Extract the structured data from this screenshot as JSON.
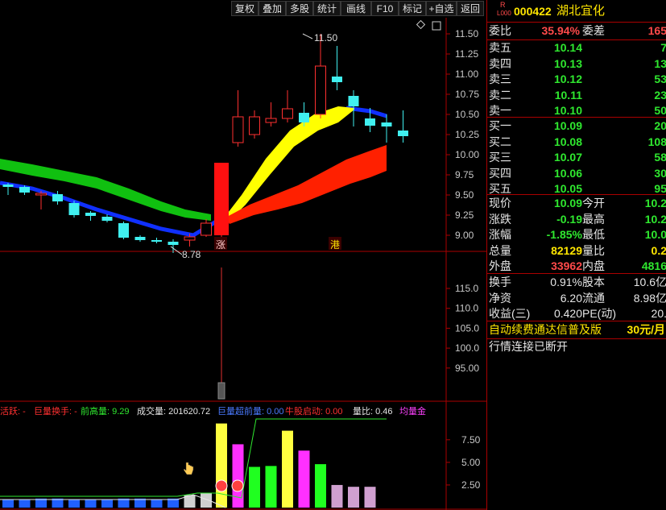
{
  "toolbar": {
    "buttons": [
      "复权",
      "叠加",
      "多股",
      "统计",
      "画线",
      "F10",
      "标记",
      "+自选",
      "返回"
    ]
  },
  "price_chart": {
    "y_ticks": [
      "11.50",
      "11.25",
      "11.00",
      "10.75",
      "10.50",
      "10.25",
      "10.00",
      "9.75",
      "9.50",
      "9.25",
      "9.00"
    ],
    "high_label": "11.50",
    "low_label": "8.78",
    "markers": [
      "涨",
      "港"
    ]
  },
  "chart_data": {
    "type": "candlestick",
    "ylim": [
      8.75,
      11.65
    ],
    "candles": [
      {
        "o": 9.63,
        "c": 9.6,
        "h": 9.65,
        "l": 9.5
      },
      {
        "o": 9.6,
        "c": 9.53,
        "h": 9.62,
        "l": 9.5
      },
      {
        "o": 9.5,
        "c": 9.52,
        "h": 9.55,
        "l": 9.32
      },
      {
        "o": 9.51,
        "c": 9.42,
        "h": 9.55,
        "l": 9.38
      },
      {
        "o": 9.4,
        "c": 9.25,
        "h": 9.43,
        "l": 9.22
      },
      {
        "o": 9.28,
        "c": 9.24,
        "h": 9.3,
        "l": 9.18
      },
      {
        "o": 9.23,
        "c": 9.18,
        "h": 9.26,
        "l": 9.16
      },
      {
        "o": 9.15,
        "c": 8.97,
        "h": 9.17,
        "l": 8.95
      },
      {
        "o": 8.98,
        "c": 8.94,
        "h": 9.0,
        "l": 8.92
      },
      {
        "o": 8.94,
        "c": 8.92,
        "h": 8.97,
        "l": 8.9
      },
      {
        "o": 8.92,
        "c": 8.88,
        "h": 8.95,
        "l": 8.78
      },
      {
        "o": 8.94,
        "c": 8.98,
        "h": 9.02,
        "l": 8.86
      },
      {
        "o": 9.0,
        "c": 9.15,
        "h": 9.2,
        "l": 8.98
      },
      {
        "o": 9.0,
        "c": 9.9,
        "h": 9.9,
        "l": 8.97
      },
      {
        "o": 10.15,
        "c": 10.47,
        "h": 10.8,
        "l": 10.1
      },
      {
        "o": 10.25,
        "c": 10.47,
        "h": 10.55,
        "l": 10.2
      },
      {
        "o": 10.4,
        "c": 10.45,
        "h": 10.65,
        "l": 10.35
      },
      {
        "o": 10.45,
        "c": 10.57,
        "h": 10.8,
        "l": 10.4
      },
      {
        "o": 10.52,
        "c": 10.4,
        "h": 10.65,
        "l": 10.35
      },
      {
        "o": 10.5,
        "c": 11.1,
        "h": 11.5,
        "l": 10.45
      },
      {
        "o": 10.97,
        "c": 10.9,
        "h": 11.35,
        "l": 10.8
      },
      {
        "o": 10.73,
        "c": 10.6,
        "h": 10.8,
        "l": 10.35
      },
      {
        "o": 10.45,
        "c": 10.36,
        "h": 10.58,
        "l": 10.28
      },
      {
        "o": 10.4,
        "c": 10.35,
        "h": 10.5,
        "l": 10.15
      },
      {
        "o": 10.3,
        "c": 10.23,
        "h": 10.55,
        "l": 10.15
      }
    ],
    "volume_values": [
      0.9,
      0.9,
      1.0,
      1.0,
      0.9,
      0.9,
      0.9,
      1.0,
      1.0,
      0.9,
      1.0,
      1.4,
      1.6,
      9.3,
      7.0,
      4.5,
      4.6,
      8.5,
      6.3,
      4.8,
      2.5,
      2.3,
      2.3,
      0,
      0
    ],
    "volume_ylim": [
      0,
      9.8
    ],
    "volume_y_ticks": [
      "7.50",
      "5.00",
      "2.50"
    ],
    "mid_y_ticks": [
      "115.0",
      "110.0",
      "105.0",
      "100.0",
      "95.00"
    ]
  },
  "indicator_legend": [
    {
      "text": "活跃: -",
      "color": "#ff3030"
    },
    {
      "text": "巨量换手: -",
      "color": "#ff3030"
    },
    {
      "text": "前高量: 9.29",
      "color": "#2fe82f"
    },
    {
      "text": "成交量: 201620.72",
      "color": "#e6e6e6"
    },
    {
      "text": "巨量超前量: 0.00",
      "color": "#4a7aff"
    },
    {
      "text": "牛股启动: 0.00",
      "color": "#ff3030"
    },
    {
      "text": "量比: 0.46",
      "color": "#e6e6e6"
    },
    {
      "text": "均量金",
      "color": "#ff40ff"
    }
  ],
  "quote": {
    "flag_r": "R",
    "flag_level": "L000",
    "code": "000422",
    "name": "湖北宜化",
    "weibi_label": "委比",
    "weibi": "35.94%",
    "weicha_label": "委差",
    "weicha": "165",
    "asks": [
      {
        "label": "卖五",
        "price": "10.14",
        "vol": "7"
      },
      {
        "label": "卖四",
        "price": "10.13",
        "vol": "13"
      },
      {
        "label": "卖三",
        "price": "10.12",
        "vol": "53"
      },
      {
        "label": "卖二",
        "price": "10.11",
        "vol": "23"
      },
      {
        "label": "卖一",
        "price": "10.10",
        "vol": "50"
      }
    ],
    "bids": [
      {
        "label": "买一",
        "price": "10.09",
        "vol": "20"
      },
      {
        "label": "买二",
        "price": "10.08",
        "vol": "108"
      },
      {
        "label": "买三",
        "price": "10.07",
        "vol": "58"
      },
      {
        "label": "买四",
        "price": "10.06",
        "vol": "30"
      },
      {
        "label": "买五",
        "price": "10.05",
        "vol": "95"
      }
    ],
    "stats": [
      {
        "l1": "现价",
        "v1": "10.09",
        "c1": "green",
        "l2": "今开",
        "v2": "10.2",
        "c2": "green"
      },
      {
        "l1": "涨跌",
        "v1": "-0.19",
        "c1": "green",
        "l2": "最高",
        "v2": "10.2",
        "c2": "green"
      },
      {
        "l1": "涨幅",
        "v1": "-1.85%",
        "c1": "green",
        "l2": "最低",
        "v2": "10.0",
        "c2": "green"
      },
      {
        "l1": "总量",
        "v1": "82129",
        "c1": "yellow",
        "l2": "量比",
        "v2": "0.2",
        "c2": "yellow"
      },
      {
        "l1": "外盘",
        "v1": "33962",
        "c1": "red",
        "l2": "内盘",
        "v2": "4816",
        "c2": "green"
      }
    ],
    "fin": [
      {
        "l1": "换手",
        "v1": "0.91%",
        "l2": "股本",
        "v2": "10.6亿"
      },
      {
        "l1": "净资",
        "v1": "6.20",
        "l2": "流通",
        "v2": "8.98亿"
      },
      {
        "l1": "收益(三)",
        "v1": "0.420",
        "l2": "PE(动)",
        "v2": "20."
      }
    ],
    "ad_text": "自动续费通达信普及版",
    "ad_price": "30元/月",
    "status": "行情连接已断开"
  }
}
